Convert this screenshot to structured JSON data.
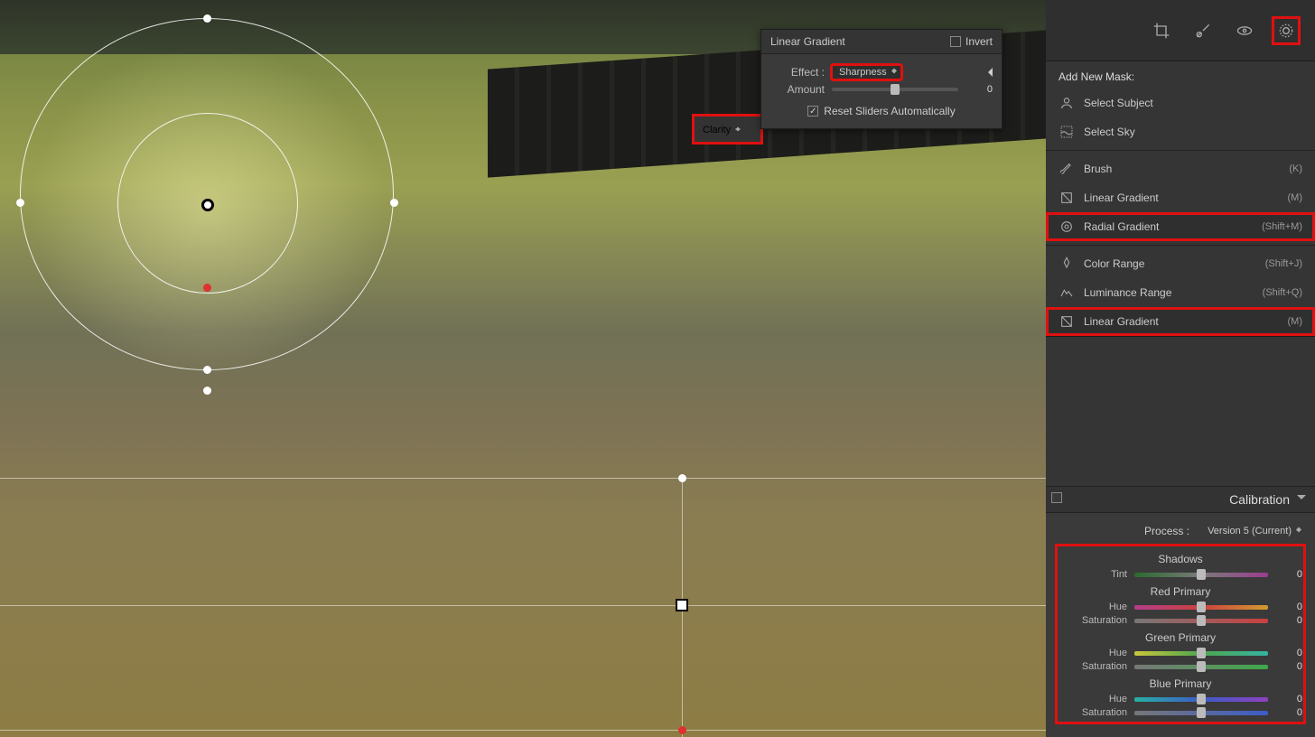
{
  "linear_panel": {
    "title": "Linear Gradient",
    "invert": "Invert",
    "effect_label": "Effect :",
    "effect_value": "Sharpness",
    "amount_label": "Amount",
    "amount_value": "0",
    "reset_label": "Reset Sliders Automatically"
  },
  "clarity_pop": "Clarity",
  "sidebar": {
    "add_mask": "Add New Mask:",
    "items": [
      {
        "label": "Select Subject",
        "kb": "",
        "icon": "person"
      },
      {
        "label": "Select Sky",
        "kb": "",
        "icon": "sky"
      },
      {
        "label": "Brush",
        "kb": "(K)",
        "icon": "brush"
      },
      {
        "label": "Linear Gradient",
        "kb": "(M)",
        "icon": "linear"
      },
      {
        "label": "Radial Gradient",
        "kb": "(Shift+M)",
        "icon": "radial"
      },
      {
        "label": "Color Range",
        "kb": "(Shift+J)",
        "icon": "color"
      },
      {
        "label": "Luminance Range",
        "kb": "(Shift+Q)",
        "icon": "luminance"
      },
      {
        "label": "Linear Gradient",
        "kb": "(M)",
        "icon": "linear"
      }
    ]
  },
  "calibration": {
    "title": "Calibration",
    "process_label": "Process :",
    "process_value": "Version 5 (Current)",
    "groups": [
      {
        "name": "Shadows",
        "rows": [
          {
            "label": "Tint",
            "val": "0",
            "cls": "gradient-a"
          }
        ]
      },
      {
        "name": "Red Primary",
        "rows": [
          {
            "label": "Hue",
            "val": "0",
            "cls": "gradient-r"
          },
          {
            "label": "Saturation",
            "val": "0",
            "cls": "gradient-sat-r"
          }
        ]
      },
      {
        "name": "Green Primary",
        "rows": [
          {
            "label": "Hue",
            "val": "0",
            "cls": "gradient-g"
          },
          {
            "label": "Saturation",
            "val": "0",
            "cls": "gradient-sat-g"
          }
        ]
      },
      {
        "name": "Blue Primary",
        "rows": [
          {
            "label": "Hue",
            "val": "0",
            "cls": "gradient-b"
          },
          {
            "label": "Saturation",
            "val": "0",
            "cls": "gradient-sat-b"
          }
        ]
      }
    ]
  }
}
